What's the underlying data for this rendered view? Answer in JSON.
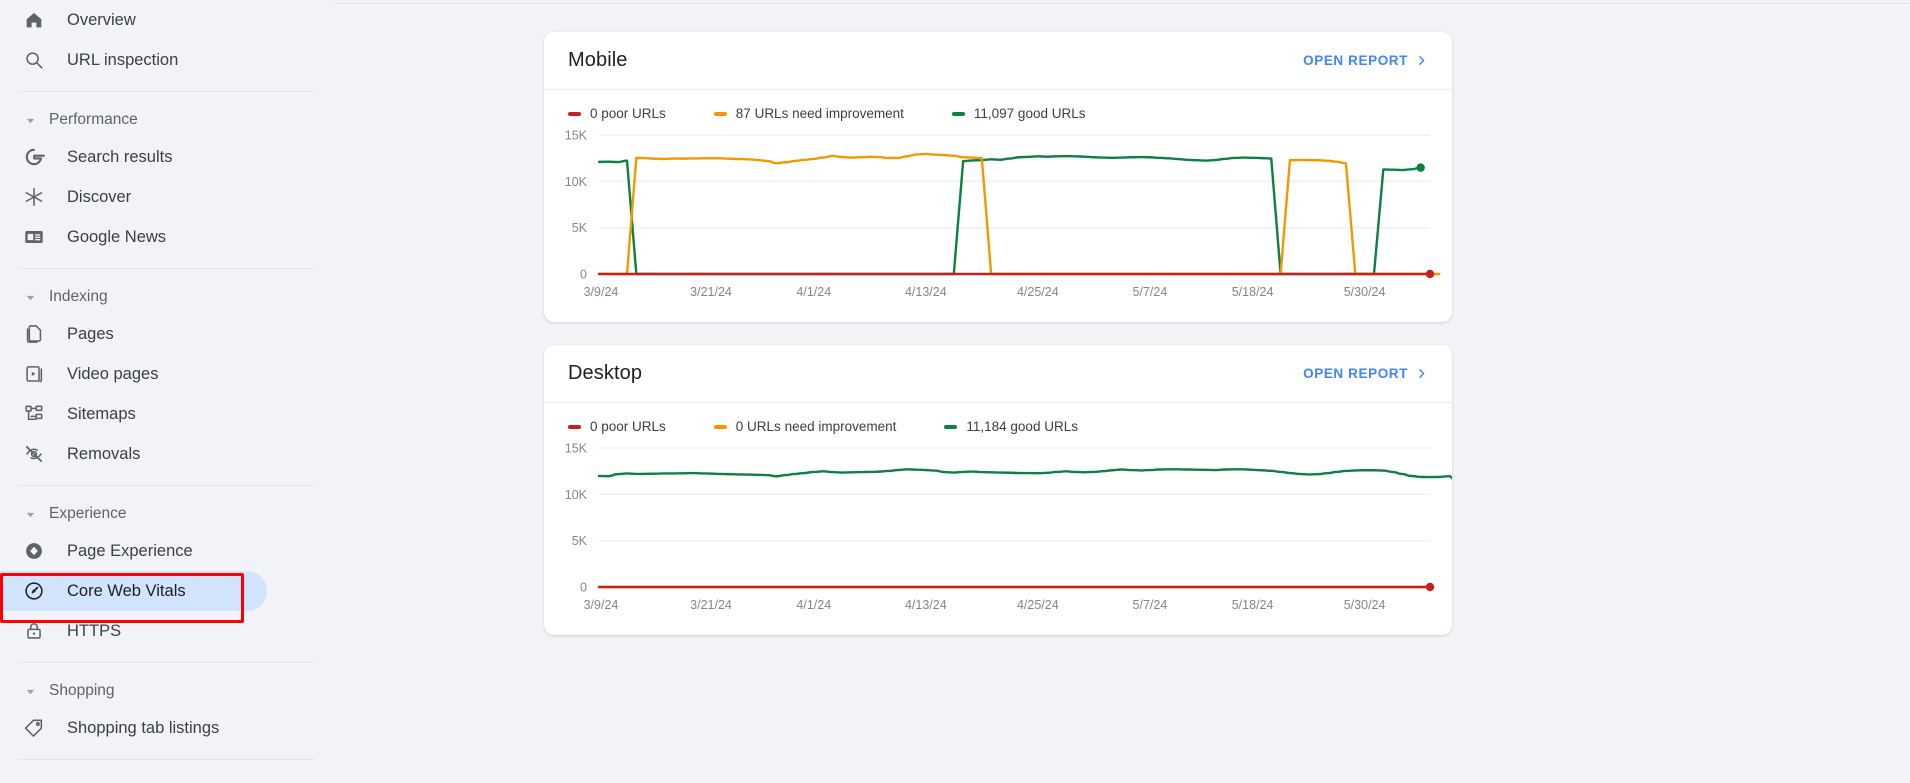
{
  "app": {
    "background": "#F1F3F6",
    "accent_blue": "#4285F4",
    "selected_pill": "#D2E3FC",
    "annotation_color": "#FF0000"
  },
  "sidebar": {
    "blocks": [
      {
        "type": "items",
        "items": [
          {
            "label": "Overview",
            "icon": "home-icon",
            "name": "sidebar-item-overview",
            "selected": false
          },
          {
            "label": "URL inspection",
            "icon": "search-icon",
            "name": "sidebar-item-url-inspection",
            "selected": false
          }
        ]
      },
      {
        "type": "divider"
      },
      {
        "type": "section",
        "label": "Performance",
        "name": "sidebar-section-performance",
        "items": [
          {
            "label": "Search results",
            "icon": "google-g-icon",
            "name": "sidebar-item-search-results",
            "selected": false
          },
          {
            "label": "Discover",
            "icon": "discover-asterisk-icon",
            "name": "sidebar-item-discover",
            "selected": false
          },
          {
            "label": "Google News",
            "icon": "google-news-icon",
            "name": "sidebar-item-google-news",
            "selected": false
          }
        ]
      },
      {
        "type": "divider"
      },
      {
        "type": "section",
        "label": "Indexing",
        "name": "sidebar-section-indexing",
        "items": [
          {
            "label": "Pages",
            "icon": "pages-icon",
            "name": "sidebar-item-pages",
            "selected": false
          },
          {
            "label": "Video pages",
            "icon": "video-pages-icon",
            "name": "sidebar-item-video-pages",
            "selected": false
          },
          {
            "label": "Sitemaps",
            "icon": "sitemaps-icon",
            "name": "sidebar-item-sitemaps",
            "selected": false
          },
          {
            "label": "Removals",
            "icon": "eye-off-icon",
            "name": "sidebar-item-removals",
            "selected": false
          }
        ]
      },
      {
        "type": "divider"
      },
      {
        "type": "section",
        "label": "Experience",
        "name": "sidebar-section-experience",
        "items": [
          {
            "label": "Page Experience",
            "icon": "page-experience-icon",
            "name": "sidebar-item-page-experience",
            "selected": false
          },
          {
            "label": "Core Web Vitals",
            "icon": "speedometer-icon",
            "name": "sidebar-item-core-web-vitals",
            "selected": true
          },
          {
            "label": "HTTPS",
            "icon": "lock-icon",
            "name": "sidebar-item-https",
            "selected": false
          }
        ]
      },
      {
        "type": "divider"
      },
      {
        "type": "section",
        "label": "Shopping",
        "name": "sidebar-section-shopping",
        "items": [
          {
            "label": "Shopping tab listings",
            "icon": "tag-icon",
            "name": "sidebar-item-shopping-tab-listings",
            "selected": false
          }
        ]
      },
      {
        "type": "divider"
      }
    ]
  },
  "cards": [
    {
      "name": "mobile-card",
      "title": "Mobile",
      "open_report_label": "OPEN REPORT",
      "legend": [
        {
          "label": "0 poor URLs",
          "color": "#C5221F",
          "series": "poor"
        },
        {
          "label": "87 URLs need improvement",
          "color": "#F29900",
          "series": "needs_improvement"
        },
        {
          "label": "11,097 good URLs",
          "color": "#0D8043",
          "series": "good"
        }
      ]
    },
    {
      "name": "desktop-card",
      "title": "Desktop",
      "open_report_label": "OPEN REPORT",
      "legend": [
        {
          "label": "0 poor URLs",
          "color": "#C5221F",
          "series": "poor"
        },
        {
          "label": "0 URLs need improvement",
          "color": "#F29900",
          "series": "needs_improvement"
        },
        {
          "label": "11,184 good URLs",
          "color": "#0D8043",
          "series": "good"
        }
      ]
    }
  ],
  "chart_data": [
    {
      "type": "line",
      "title": "Mobile",
      "xlabel": "",
      "ylabel": "",
      "ylim": [
        0,
        15000
      ],
      "yticks": [
        0,
        5000,
        10000,
        15000
      ],
      "ytick_labels": [
        "0",
        "5K",
        "10K",
        "15K"
      ],
      "grid": true,
      "legend_position": "top-left",
      "xtick_labels": [
        "3/9/24",
        "3/21/24",
        "4/1/24",
        "4/13/24",
        "4/25/24",
        "5/7/24",
        "5/18/24",
        "5/30/24"
      ],
      "xtick_indices": [
        0,
        12,
        23,
        35,
        47,
        59,
        70,
        82
      ],
      "x": [
        "3/7/24",
        "3/8/24",
        "3/9/24",
        "3/10/24",
        "3/11/24",
        "3/12/24",
        "3/13/24",
        "3/14/24",
        "3/15/24",
        "3/16/24",
        "3/17/24",
        "3/18/24",
        "3/19/24",
        "3/20/24",
        "3/21/24",
        "3/22/24",
        "3/23/24",
        "3/24/24",
        "3/25/24",
        "3/26/24",
        "3/27/24",
        "3/28/24",
        "3/29/24",
        "3/30/24",
        "3/31/24",
        "4/1/24",
        "4/2/24",
        "4/3/24",
        "4/4/24",
        "4/5/24",
        "4/6/24",
        "4/7/24",
        "4/8/24",
        "4/9/24",
        "4/10/24",
        "4/11/24",
        "4/12/24",
        "4/13/24",
        "4/14/24",
        "4/15/24",
        "4/16/24",
        "4/17/24",
        "4/18/24",
        "4/19/24",
        "4/20/24",
        "4/21/24",
        "4/22/24",
        "4/23/24",
        "4/24/24",
        "4/25/24",
        "4/26/24",
        "4/27/24",
        "4/28/24",
        "4/29/24",
        "4/30/24",
        "5/1/24",
        "5/2/24",
        "5/3/24",
        "5/4/24",
        "5/5/24",
        "5/6/24",
        "5/7/24",
        "5/8/24",
        "5/9/24",
        "5/10/24",
        "5/11/24",
        "5/12/24",
        "5/13/24",
        "5/14/24",
        "5/15/24",
        "5/16/24",
        "5/17/24",
        "5/18/24",
        "5/19/24",
        "5/20/24",
        "5/21/24",
        "5/22/24",
        "5/23/24",
        "5/24/24",
        "5/25/24",
        "5/26/24",
        "5/27/24",
        "5/28/24",
        "5/29/24",
        "5/30/24",
        "5/31/24",
        "6/1/24",
        "6/2/24",
        "6/3/24",
        "6/4/24"
      ],
      "series": [
        {
          "name": "11,097 good URLs",
          "color": "#0D8043",
          "end_marker": true,
          "values": [
            12100,
            12120,
            12080,
            12230,
            0,
            0,
            0,
            0,
            0,
            0,
            0,
            0,
            0,
            0,
            0,
            0,
            0,
            0,
            0,
            0,
            0,
            0,
            0,
            0,
            0,
            0,
            0,
            0,
            0,
            0,
            0,
            0,
            0,
            0,
            0,
            0,
            0,
            0,
            0,
            12180,
            12250,
            12300,
            12380,
            12330,
            12460,
            12600,
            12640,
            12700,
            12660,
            12700,
            12720,
            12700,
            12660,
            12600,
            12560,
            12540,
            12560,
            12600,
            12620,
            12600,
            12540,
            12480,
            12400,
            12320,
            12280,
            12240,
            12300,
            12420,
            12520,
            12560,
            12540,
            12500,
            12460,
            0,
            0,
            0,
            0,
            0,
            0,
            0,
            0,
            0,
            0,
            0,
            11280,
            11260,
            11220,
            11300,
            11480
          ]
        },
        {
          "name": "87 URLs need improvement",
          "color": "#F29900",
          "end_marker": false,
          "values": [
            0,
            0,
            0,
            0,
            12540,
            12500,
            12440,
            12420,
            12460,
            12450,
            12470,
            12480,
            12500,
            12480,
            12440,
            12400,
            12380,
            12300,
            12200,
            11960,
            12060,
            12200,
            12320,
            12420,
            12560,
            12740,
            12620,
            12560,
            12600,
            12650,
            12620,
            12520,
            12520,
            12700,
            12900,
            12960,
            12880,
            12840,
            12760,
            12600,
            12560,
            12500,
            0,
            0,
            0,
            0,
            0,
            0,
            0,
            0,
            0,
            0,
            0,
            0,
            0,
            0,
            0,
            0,
            0,
            0,
            0,
            0,
            0,
            0,
            0,
            0,
            0,
            0,
            0,
            0,
            0,
            0,
            0,
            0,
            12280,
            12300,
            12300,
            12280,
            12220,
            12120,
            11940,
            0,
            0,
            0,
            0,
            0,
            0,
            0,
            0,
            0,
            0
          ]
        },
        {
          "name": "0 poor URLs",
          "color": "#C5221F",
          "end_marker": true,
          "values": [
            0,
            0,
            0,
            0,
            0,
            0,
            0,
            0,
            0,
            0,
            0,
            0,
            0,
            0,
            0,
            0,
            0,
            0,
            0,
            0,
            0,
            0,
            0,
            0,
            0,
            0,
            0,
            0,
            0,
            0,
            0,
            0,
            0,
            0,
            0,
            0,
            0,
            0,
            0,
            0,
            0,
            0,
            0,
            0,
            0,
            0,
            0,
            0,
            0,
            0,
            0,
            0,
            0,
            0,
            0,
            0,
            0,
            0,
            0,
            0,
            0,
            0,
            0,
            0,
            0,
            0,
            0,
            0,
            0,
            0,
            0,
            0,
            0,
            0,
            0,
            0,
            0,
            0,
            0,
            0,
            0,
            0,
            0,
            0,
            0,
            0,
            0,
            0,
            0,
            0
          ]
        }
      ]
    },
    {
      "type": "line",
      "title": "Desktop",
      "xlabel": "",
      "ylabel": "",
      "ylim": [
        0,
        15000
      ],
      "yticks": [
        0,
        5000,
        10000,
        15000
      ],
      "ytick_labels": [
        "0",
        "5K",
        "10K",
        "15K"
      ],
      "grid": true,
      "legend_position": "top-left",
      "xtick_labels": [
        "3/9/24",
        "3/21/24",
        "4/1/24",
        "4/13/24",
        "4/25/24",
        "5/7/24",
        "5/18/24",
        "5/30/24"
      ],
      "xtick_indices": [
        0,
        12,
        23,
        35,
        47,
        59,
        70,
        82
      ],
      "x": [
        "3/7/24",
        "3/8/24",
        "3/9/24",
        "3/10/24",
        "3/11/24",
        "3/12/24",
        "3/13/24",
        "3/14/24",
        "3/15/24",
        "3/16/24",
        "3/17/24",
        "3/18/24",
        "3/19/24",
        "3/20/24",
        "3/21/24",
        "3/22/24",
        "3/23/24",
        "3/24/24",
        "3/25/24",
        "3/26/24",
        "3/27/24",
        "3/28/24",
        "3/29/24",
        "3/30/24",
        "3/31/24",
        "4/1/24",
        "4/2/24",
        "4/3/24",
        "4/4/24",
        "4/5/24",
        "4/6/24",
        "4/7/24",
        "4/8/24",
        "4/9/24",
        "4/10/24",
        "4/11/24",
        "4/12/24",
        "4/13/24",
        "4/14/24",
        "4/15/24",
        "4/16/24",
        "4/17/24",
        "4/18/24",
        "4/19/24",
        "4/20/24",
        "4/21/24",
        "4/22/24",
        "4/23/24",
        "4/24/24",
        "4/25/24",
        "4/26/24",
        "4/27/24",
        "4/28/24",
        "4/29/24",
        "4/30/24",
        "5/1/24",
        "5/2/24",
        "5/3/24",
        "5/4/24",
        "5/5/24",
        "5/6/24",
        "5/7/24",
        "5/8/24",
        "5/9/24",
        "5/10/24",
        "5/11/24",
        "5/12/24",
        "5/13/24",
        "5/14/24",
        "5/15/24",
        "5/16/24",
        "5/17/24",
        "5/18/24",
        "5/19/24",
        "5/20/24",
        "5/21/24",
        "5/22/24",
        "5/23/24",
        "5/24/24",
        "5/25/24",
        "5/26/24",
        "5/27/24",
        "5/28/24",
        "5/29/24",
        "5/30/24",
        "5/31/24",
        "6/1/24",
        "6/2/24",
        "6/3/24",
        "6/4/24"
      ],
      "series": [
        {
          "name": "11,184 good URLs",
          "color": "#0D8043",
          "end_marker": true,
          "values": [
            11980,
            11960,
            12180,
            12250,
            12200,
            12210,
            12230,
            12250,
            12260,
            12270,
            12300,
            12260,
            12240,
            12200,
            12180,
            12150,
            12130,
            12100,
            12080,
            11950,
            12080,
            12200,
            12300,
            12420,
            12480,
            12400,
            12350,
            12380,
            12400,
            12420,
            12450,
            12520,
            12620,
            12700,
            12660,
            12620,
            12560,
            12400,
            12350,
            12420,
            12460,
            12400,
            12380,
            12350,
            12330,
            12300,
            12290,
            12280,
            12320,
            12420,
            12480,
            12420,
            12380,
            12420,
            12500,
            12600,
            12680,
            12620,
            12580,
            12620,
            12680,
            12700,
            12700,
            12680,
            12660,
            12640,
            12620,
            12680,
            12700,
            12700,
            12650,
            12600,
            12540,
            12420,
            12300,
            12200,
            12150,
            12180,
            12280,
            12420,
            12520,
            12580,
            12600,
            12600,
            12560,
            12420,
            12200,
            11980,
            11880,
            11860,
            11880,
            11960,
            11200
          ]
        },
        {
          "name": "0 URLs need improvement",
          "color": "#F29900",
          "end_marker": false,
          "values": [
            0,
            0,
            0,
            0,
            0,
            0,
            0,
            0,
            0,
            0,
            0,
            0,
            0,
            0,
            0,
            0,
            0,
            0,
            0,
            0,
            0,
            0,
            0,
            0,
            0,
            0,
            0,
            0,
            0,
            0,
            0,
            0,
            0,
            0,
            0,
            0,
            0,
            0,
            0,
            0,
            0,
            0,
            0,
            0,
            0,
            0,
            0,
            0,
            0,
            0,
            0,
            0,
            0,
            0,
            0,
            0,
            0,
            0,
            0,
            0,
            0,
            0,
            0,
            0,
            0,
            0,
            0,
            0,
            0,
            0,
            0,
            0,
            0,
            0,
            0,
            0,
            0,
            0,
            0,
            0,
            0,
            0,
            0,
            0,
            0,
            0,
            0,
            0,
            0,
            0
          ]
        },
        {
          "name": "0 poor URLs",
          "color": "#C5221F",
          "end_marker": true,
          "values": [
            0,
            0,
            0,
            0,
            0,
            0,
            0,
            0,
            0,
            0,
            0,
            0,
            0,
            0,
            0,
            0,
            0,
            0,
            0,
            0,
            0,
            0,
            0,
            0,
            0,
            0,
            0,
            0,
            0,
            0,
            0,
            0,
            0,
            0,
            0,
            0,
            0,
            0,
            0,
            0,
            0,
            0,
            0,
            0,
            0,
            0,
            0,
            0,
            0,
            0,
            0,
            0,
            0,
            0,
            0,
            0,
            0,
            0,
            0,
            0,
            0,
            0,
            0,
            0,
            0,
            0,
            0,
            0,
            0,
            0,
            0,
            0,
            0,
            0,
            0,
            0,
            0,
            0,
            0,
            0,
            0,
            0,
            0,
            0,
            0,
            0,
            0,
            0,
            0,
            0
          ]
        }
      ]
    }
  ]
}
